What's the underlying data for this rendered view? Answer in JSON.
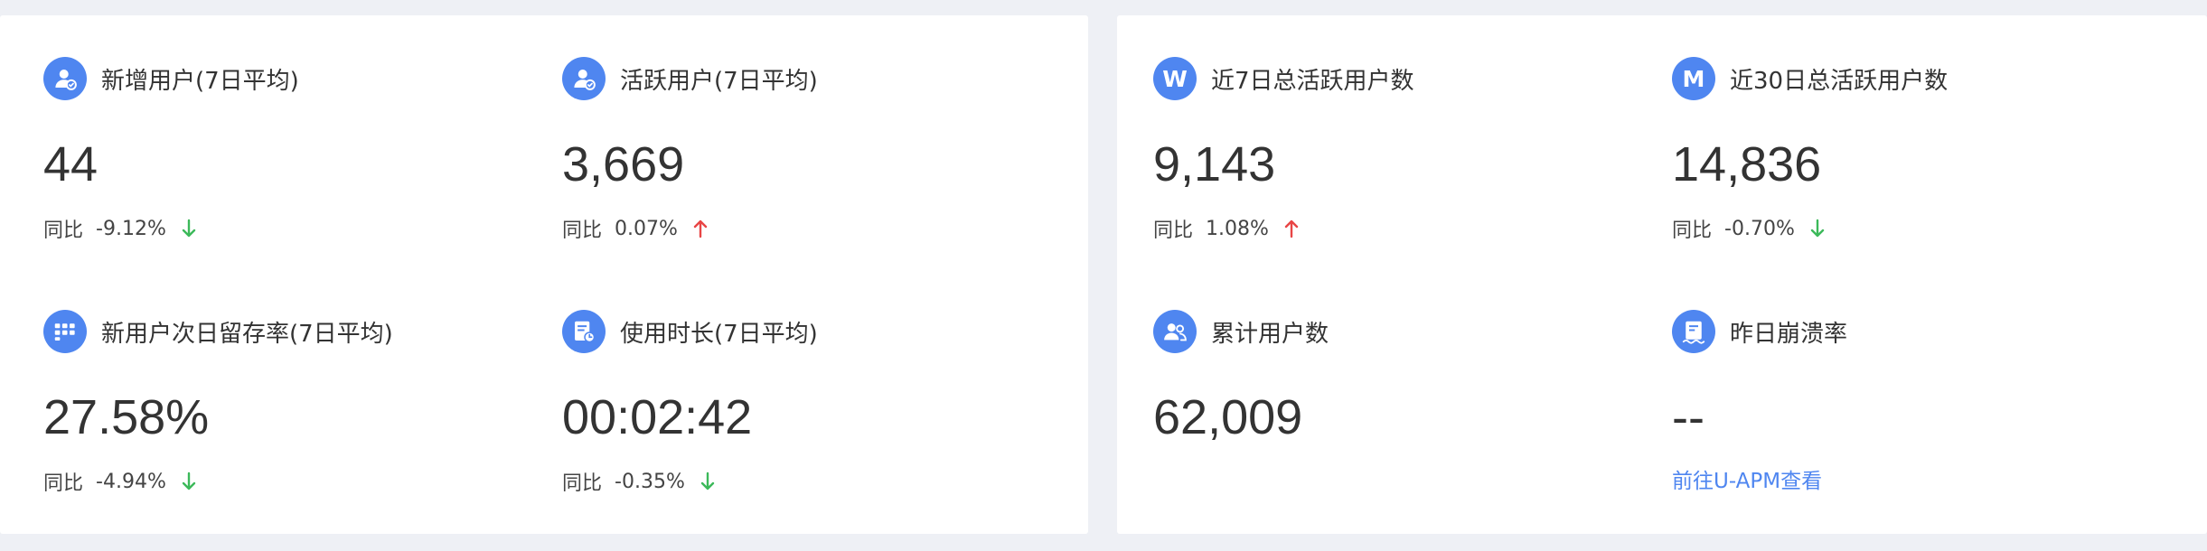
{
  "colors": {
    "accent": "#4f86f0",
    "up": "#e84545",
    "down": "#3cb95a",
    "background": "#eef0f5",
    "card": "#ffffff"
  },
  "left_panel": {
    "metrics": [
      {
        "title": "新增用户(7日平均)",
        "value": "44",
        "compare_label": "同比",
        "compare_value": "-9.12%",
        "trend": "down",
        "icon": "user-badge-icon"
      },
      {
        "title": "活跃用户(7日平均)",
        "value": "3,669",
        "compare_label": "同比",
        "compare_value": "0.07%",
        "trend": "up",
        "icon": "user-check-icon"
      },
      {
        "title": "新用户次日留存率(7日平均)",
        "value": "27.58%",
        "compare_label": "同比",
        "compare_value": "-4.94%",
        "trend": "down",
        "icon": "grid-icon"
      },
      {
        "title": "使用时长(7日平均)",
        "value": "00:02:42",
        "compare_label": "同比",
        "compare_value": "-0.35%",
        "trend": "down",
        "icon": "document-clock-icon"
      }
    ]
  },
  "right_panel": {
    "metrics": [
      {
        "title": "近7日总活跃用户数",
        "value": "9,143",
        "compare_label": "同比",
        "compare_value": "1.08%",
        "trend": "up",
        "icon": "letter-w-icon",
        "icon_letter": "W"
      },
      {
        "title": "近30日总活跃用户数",
        "value": "14,836",
        "compare_label": "同比",
        "compare_value": "-0.70%",
        "trend": "down",
        "icon": "letter-m-icon",
        "icon_letter": "M"
      },
      {
        "title": "累计用户数",
        "value": "62,009",
        "icon": "users-group-icon"
      },
      {
        "title": "昨日崩溃率",
        "value": "--",
        "link_text": "前往U-APM查看",
        "icon": "crash-report-icon"
      }
    ]
  }
}
